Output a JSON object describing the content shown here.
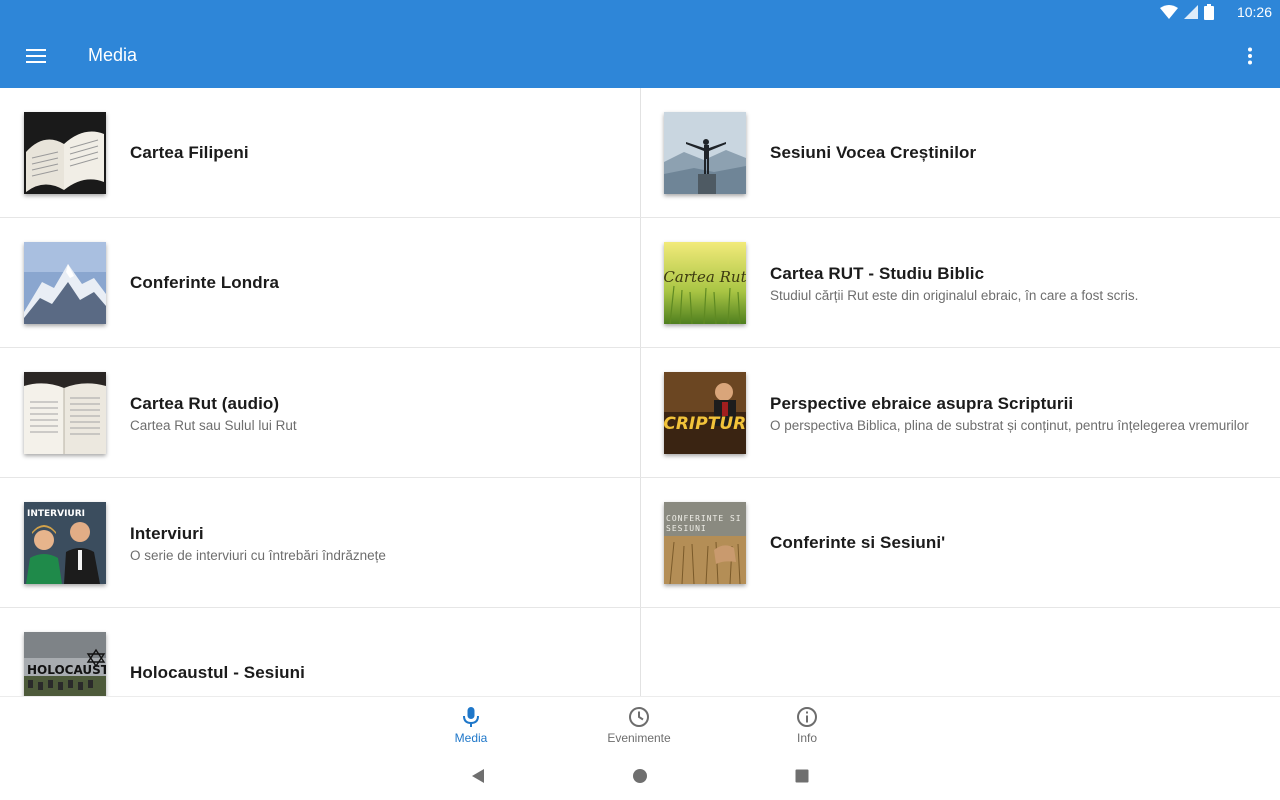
{
  "status_bar": {
    "time": "10:26",
    "icons": [
      "wifi-icon",
      "signal-icon",
      "battery-icon"
    ]
  },
  "app_bar": {
    "title": "Media",
    "menu_icon": "menu-icon",
    "more_icon": "more-vert-icon"
  },
  "colors": {
    "primary": "#2e86d8",
    "accent": "#1f77c9"
  },
  "media_items": [
    {
      "title": "Cartea Filipeni",
      "subtitle": "",
      "thumb": "open-bible-image"
    },
    {
      "title": "Sesiuni Vocea Creștinilor",
      "subtitle": "",
      "thumb": "man-on-mountain-image"
    },
    {
      "title": "Conferinte Londra",
      "subtitle": "",
      "thumb": "snowy-mountain-image"
    },
    {
      "title": "Cartea RUT - Studiu Biblic",
      "subtitle": "Studiul cărții Rut este din originalul ebraic, în care a fost scris.",
      "thumb": "wheat-field-image",
      "thumb_text": "Cartea Rut"
    },
    {
      "title": "Cartea Rut (audio)",
      "subtitle": "Cartea Rut sau Sulul lui Rut",
      "thumb": "open-book-image"
    },
    {
      "title": "Perspective ebraice asupra Scripturii",
      "subtitle": "O perspectiva Biblica, plina de substrat și conținut, pentru înțelegerea vremurilor",
      "thumb": "scripturii-image",
      "thumb_text": "SCRIPTURII"
    },
    {
      "title": "Interviuri",
      "subtitle": "O serie de interviuri cu întrebări îndrăznețe",
      "thumb": "interview-image",
      "thumb_text": "INTERVIURI"
    },
    {
      "title": "Conferinte si Sesiuni'",
      "subtitle": "",
      "thumb": "wheat-hand-image",
      "thumb_text": "CONFERINTE SI SESIUNI"
    },
    {
      "title": "Holocaustul - Sesiuni",
      "subtitle": "",
      "thumb": "holocaust-image",
      "thumb_text": "HOLOCAUST"
    }
  ],
  "bottom_nav": [
    {
      "label": "Media",
      "icon": "microphone-icon",
      "active": true
    },
    {
      "label": "Evenimente",
      "icon": "clock-icon",
      "active": false
    },
    {
      "label": "Info",
      "icon": "info-icon",
      "active": false
    }
  ],
  "system_nav": [
    "back-icon",
    "home-icon",
    "recents-icon"
  ]
}
